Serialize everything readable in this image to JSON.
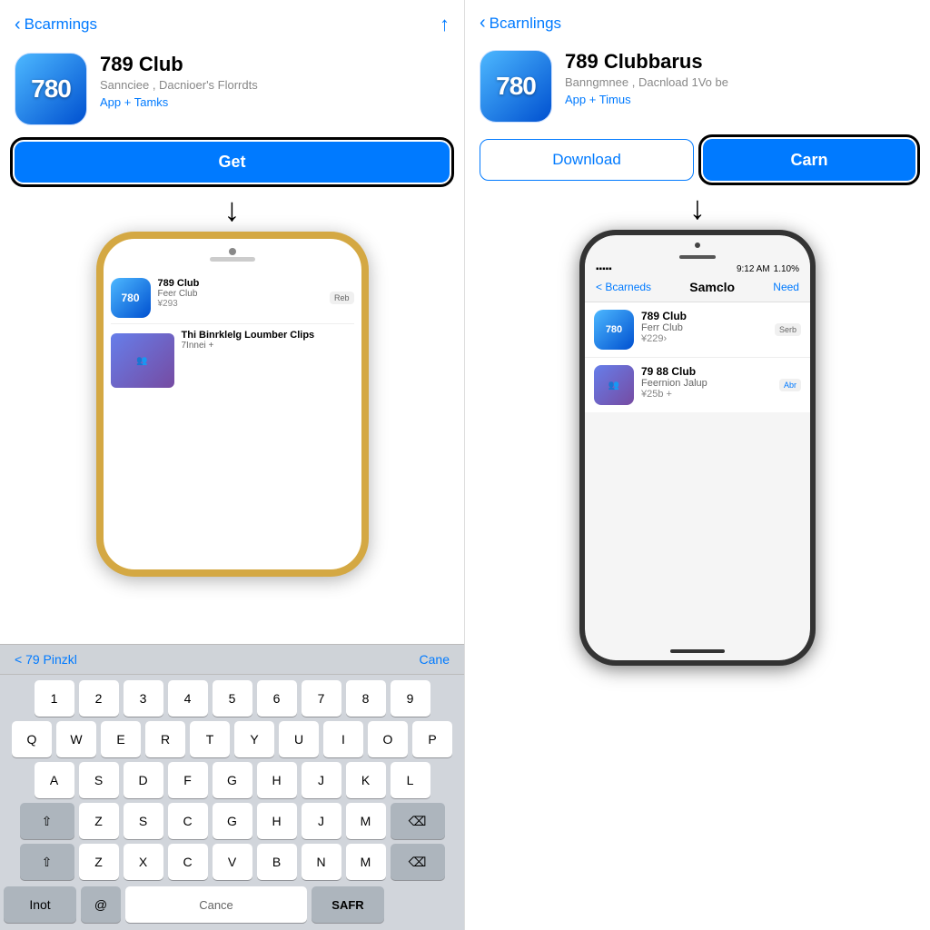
{
  "left_panel": {
    "nav": {
      "back_label": "Bcarmings",
      "icon": "🕹"
    },
    "app": {
      "name": "789 Club",
      "subtitle": "Sannciee , Dacnioer's Florrdts",
      "category": "App + Tamks",
      "icon_text": "780"
    },
    "get_button": "Get",
    "phone_screen": {
      "app_name": "789 Club",
      "app_sub": "Feer Club",
      "app_price": "¥293",
      "app_badge": "Reb",
      "group_title": "Thi Binrklelg Loumber Clips",
      "group_sub": "7Innei +"
    },
    "keyboard": {
      "toolbar_left": "< 79 Pinzkl",
      "toolbar_right": "Cane",
      "numbers": [
        "1",
        "2",
        "3",
        "4",
        "5",
        "6",
        "7",
        "8",
        "9"
      ],
      "row1": [
        "Q",
        "W",
        "E",
        "R",
        "T",
        "Y",
        "U",
        "I",
        "O",
        "P"
      ],
      "row2": [
        "A",
        "S",
        "D",
        "F",
        "G",
        "H",
        "J",
        "K",
        "L"
      ],
      "row3a": [
        "Z",
        "S",
        "C",
        "G",
        "H",
        "J",
        "M"
      ],
      "row4a": [
        "Z",
        "X",
        "C",
        "V",
        "B",
        "N",
        "M"
      ],
      "bottom_left": "Inot",
      "bottom_center": "Cance",
      "bottom_right": "SAFR"
    }
  },
  "right_panel": {
    "nav": {
      "back_label": "Bcarnlings"
    },
    "app": {
      "name": "789 Clubbarus",
      "subtitle": "Banngmnee , Dacnload 1Vo be",
      "category": "App + Timus",
      "icon_text": "780"
    },
    "download_button": "Download",
    "carn_button": "Carn",
    "phone": {
      "status_time": "9:12 AM",
      "status_signal": "▪▪▪▪▪",
      "status_battery": "1.10%",
      "nav_back": "< Bcarneds",
      "nav_title": "Samclo",
      "nav_action": "Need",
      "item1_name": "789 Club",
      "item1_sub": "Ferr Club",
      "item1_price": "¥229",
      "item1_badge": "Serb",
      "item2_name": "79 88 Club",
      "item2_sub": "Feernion Jalup",
      "item2_price": "¥25b +",
      "item2_badge": "Abr",
      "icon_text": "780"
    }
  }
}
